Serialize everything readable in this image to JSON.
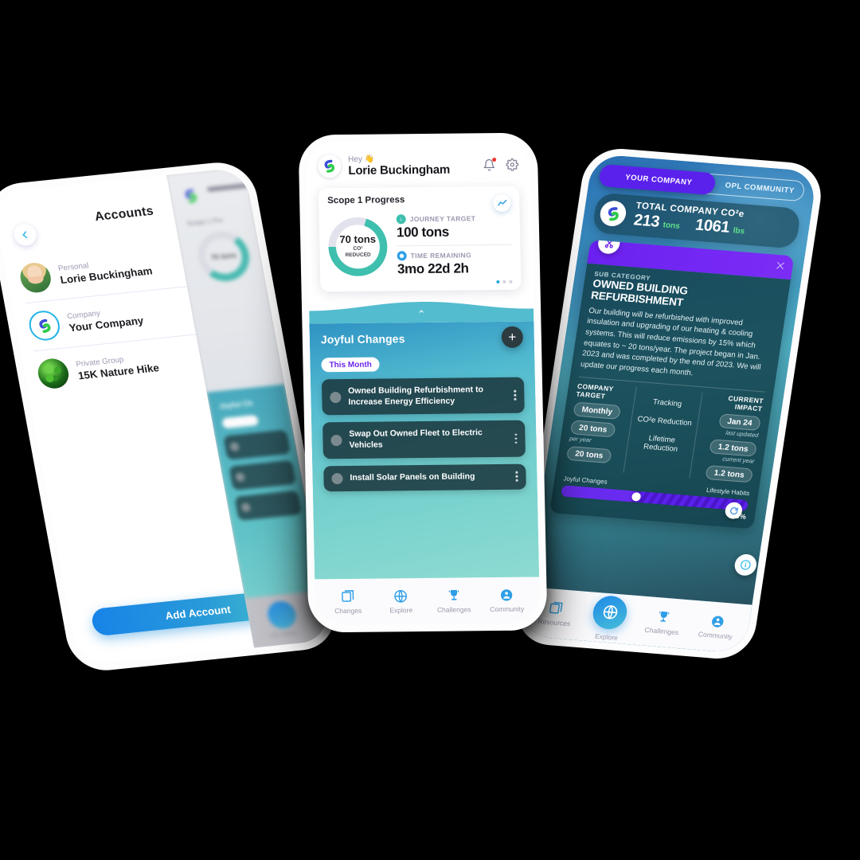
{
  "brand": {
    "logo_icon": "app-logo-icon",
    "accent_blue": "#2a9ee8",
    "accent_green": "#3fbfae",
    "accent_purple": "#5b21ec"
  },
  "left_phone": {
    "title": "Accounts",
    "back_icon": "chevron-left-icon",
    "menu_icon": "kebab-menu-icon",
    "accounts": [
      {
        "kind": "Personal",
        "name": "Lorie Buckingham",
        "avatar": "person-photo-avatar"
      },
      {
        "kind": "Company",
        "name": "Your Company",
        "avatar": "company-logo-avatar"
      },
      {
        "kind": "Private Group",
        "name": "15K Nature Hike",
        "avatar": "nature-photo-avatar"
      }
    ],
    "cta_label": "Add Account",
    "peek": {
      "greeting_label": "Hey",
      "section_label": "Scope 1 Pro",
      "donut_value": "70 tons",
      "panel_title": "Joyful Ch",
      "chip": "This Month",
      "nav_label": "Life Habits"
    }
  },
  "mid_phone": {
    "header": {
      "greeting": "Hey 👋",
      "user_name": "Lorie Buckingham",
      "bell_icon": "notification-bell-icon",
      "gear_icon": "settings-gear-icon"
    },
    "progress_card": {
      "title": "Scope 1 Progress",
      "trend_icon": "trend-line-icon",
      "donut": {
        "value": "70 tons",
        "sub_line1": "CO²",
        "sub_line2": "REDUCED",
        "percent": 70
      },
      "stats": [
        {
          "label": "JOURNEY TARGET",
          "value": "100 tons",
          "icon": "download-arrow-icon"
        },
        {
          "label": "TIME REMAINING",
          "value": "3mo 22d 2h",
          "icon": "clock-icon"
        }
      ],
      "pager": {
        "total": 3,
        "active": 1
      }
    },
    "joyful": {
      "title": "Joyful Changes",
      "add_icon": "plus-icon",
      "chip": "This Month",
      "items": [
        {
          "text": "Owned Building Refurbishment to Increase Energy Efficiency"
        },
        {
          "text": "Swap Out Owned Fleet to Electric Vehicles"
        },
        {
          "text": "Install Solar Panels on Building"
        }
      ]
    },
    "nav": [
      {
        "label": "Changes",
        "icon": "changes-book-icon"
      },
      {
        "label": "Explore",
        "icon": "globe-icon"
      },
      {
        "label": "Challenges",
        "icon": "trophy-icon"
      },
      {
        "label": "Community",
        "icon": "community-people-icon"
      }
    ]
  },
  "right_phone": {
    "toggle": {
      "active": "YOUR COMPANY",
      "inactive": "OPL COMMUNITY"
    },
    "total": {
      "title": "TOTAL COMPANY CO²e",
      "tons_value": "213",
      "tons_unit": "tons",
      "lbs_value": "1061",
      "lbs_unit": "lbs"
    },
    "detail": {
      "header_icon": "tools-icon",
      "close_icon": "close-x-icon",
      "sub_label": "SUB CATEGORY",
      "title": "OWNED BUILDING REFURBISHMENT",
      "body": "Our building will be refurbished with improved insulation and upgrading of our heating & cooling systems. This will reduce emissions by 15% which equates to ~ 20 tons/year. The project began in Jan. 2023 and was completed by the end of 2023. We will update our progress each month."
    },
    "metrics": {
      "target_header": "COMPANY TARGET",
      "target_period": "Monthly",
      "target_value_1": "20 tons",
      "target_value_1_sub": "per year",
      "target_value_2": "20 tons",
      "tracking_header": "Tracking",
      "tracking_row_1": "CO²e Reduction",
      "tracking_row_2": "Lifetime Reduction",
      "impact_header": "CURRENT IMPACT",
      "impact_date": "Jan 24",
      "impact_date_sub": "last updated",
      "impact_value_1": "1.2 tons",
      "impact_value_1_sub": "current year",
      "impact_value_2": "1.2 tons"
    },
    "slider": {
      "left_label": "Joyful Changes",
      "right_label": "Lifestyle Habits",
      "percent_label": "9%",
      "refresh_icon": "refresh-icon",
      "info_icon": "info-icon"
    },
    "nav": [
      {
        "label": "Resources",
        "icon": "resources-book-icon"
      },
      {
        "label": "Explore",
        "icon": "globe-icon"
      },
      {
        "label": "Challenges",
        "icon": "trophy-icon"
      },
      {
        "label": "Community",
        "icon": "community-people-icon"
      }
    ]
  }
}
